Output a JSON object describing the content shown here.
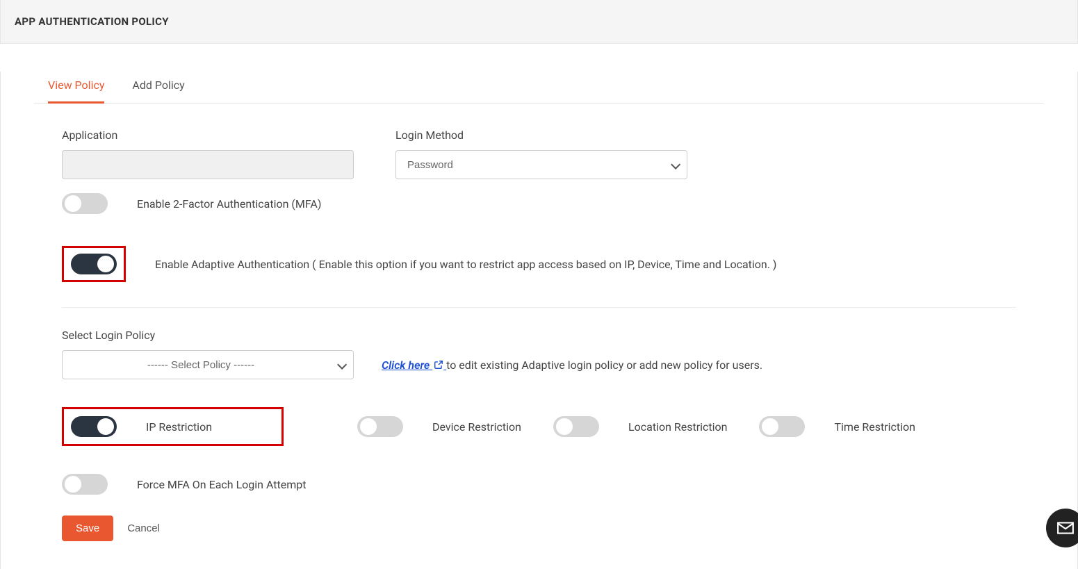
{
  "header": {
    "title": "APP AUTHENTICATION POLICY"
  },
  "tabs": {
    "view": "View Policy",
    "add": "Add Policy"
  },
  "form": {
    "application_label": "Application",
    "application_value": "",
    "login_method_label": "Login Method",
    "login_method_value": "Password",
    "mfa_label": "Enable 2-Factor Authentication (MFA)",
    "adaptive_label": "Enable Adaptive Authentication ( Enable this option if you want to restrict app access based on IP, Device, Time and Location. )",
    "select_login_policy_label": "Select Login Policy",
    "select_login_policy_value": "------ Select Policy ------",
    "click_here": "Click here",
    "click_here_suffix": " to edit existing Adaptive login policy or add new policy for users.",
    "ip_restriction": "IP Restriction",
    "device_restriction": "Device Restriction",
    "location_restriction": "Location Restriction",
    "time_restriction": "Time Restriction",
    "force_mfa": "Force MFA On Each Login Attempt",
    "save": "Save",
    "cancel": "Cancel"
  }
}
